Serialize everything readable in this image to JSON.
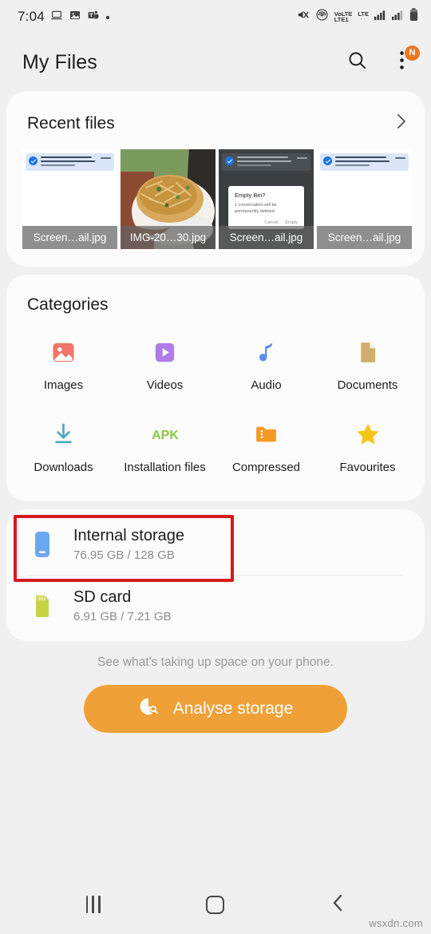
{
  "status_bar": {
    "clock": "7:04",
    "left_icons": [
      "laptop-icon",
      "photos-icon",
      "teams-icon",
      "dot-indicator"
    ],
    "right_icons": [
      "mute-icon",
      "hotspot-icon",
      "volte-icon",
      "lte-icon",
      "signal-sim1-icon",
      "signal-sim2-icon",
      "battery-icon"
    ],
    "volte_line1": "VoLTE",
    "volte_line2": "LTE1",
    "lte_line1": "LTE",
    "lte_line2": "•↑"
  },
  "app_bar": {
    "title": "My Files",
    "search_icon": "search-icon",
    "more_icon": "more-vert-icon",
    "badge": "N",
    "badge_color": "#e87722"
  },
  "recent_files": {
    "title": "Recent files",
    "more_arrow": "chevron-right-icon",
    "items": [
      {
        "name": "Screen…ail.jpg",
        "kind": "screenshot-light"
      },
      {
        "name": "IMG-20…30.jpg",
        "kind": "photo-food"
      },
      {
        "name": "Screen…ail.jpg",
        "kind": "screenshot-dark-dialog"
      },
      {
        "name": "Screen…ail.jpg",
        "kind": "screenshot-light"
      }
    ],
    "dialog_thumb": {
      "title": "Empty Bin?",
      "text": "1 conversation will be permanently deleted",
      "cancel": "Cancel",
      "confirm": "Empty"
    }
  },
  "categories": {
    "title": "Categories",
    "items": [
      {
        "label": "Images",
        "icon": "image-icon",
        "color": "#f0756a"
      },
      {
        "label": "Videos",
        "icon": "video-play-icon",
        "color": "#b07ce8"
      },
      {
        "label": "Audio",
        "icon": "music-note-icon",
        "color": "#5b8def"
      },
      {
        "label": "Documents",
        "icon": "document-icon",
        "color": "#d3ad6b"
      },
      {
        "label": "Downloads",
        "icon": "download-icon",
        "color": "#4aa8bf"
      },
      {
        "label": "Installation files",
        "icon": "apk-icon",
        "color": "#8cc63f"
      },
      {
        "label": "Compressed",
        "icon": "folder-zip-icon",
        "color": "#f59a23"
      },
      {
        "label": "Favourites",
        "icon": "star-icon",
        "color": "#f5c518"
      }
    ]
  },
  "storage": {
    "items": [
      {
        "name": "Internal storage",
        "usage": "76.95 GB / 128 GB",
        "icon": "phone-icon",
        "highlighted": true
      },
      {
        "name": "SD card",
        "usage": "6.91 GB / 7.21 GB",
        "icon": "sd-card-icon",
        "highlighted": false
      }
    ],
    "highlight_color": "#d61a1a"
  },
  "analyse": {
    "hint": "See what's taking up space on your phone.",
    "button_label": "Analyse storage",
    "button_icon": "pie-chart-search-icon",
    "button_color": "#efa037"
  },
  "nav_bar": {
    "recents_label": "recents-icon",
    "home_label": "home-icon",
    "back_label": "back-icon"
  },
  "watermark": "wsxdn.com"
}
